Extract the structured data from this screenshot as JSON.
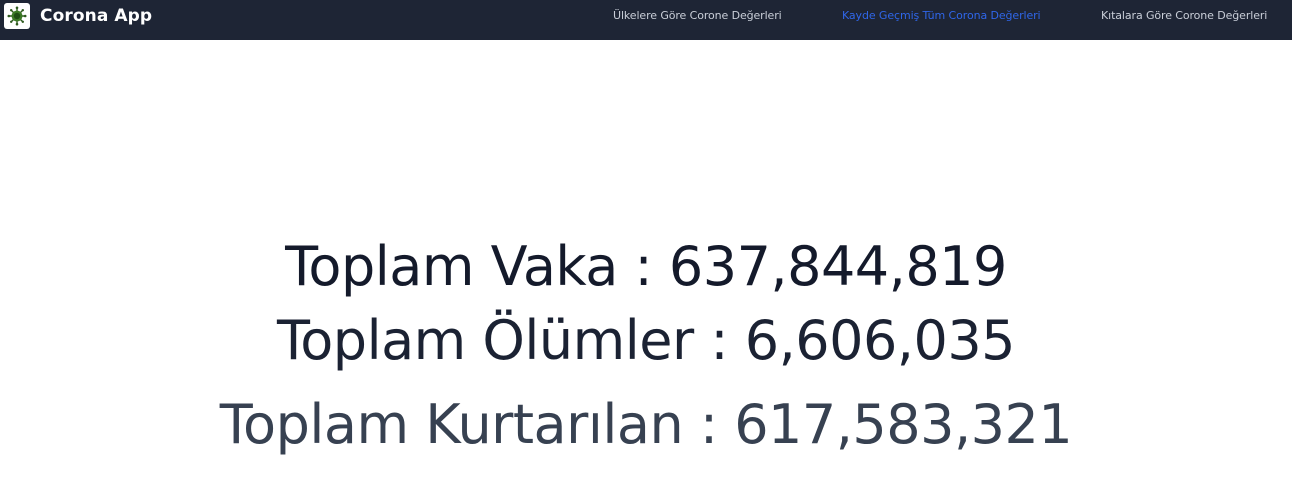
{
  "app": {
    "title": "Corona App",
    "logo_icon": "virus-icon",
    "accent_color": "#2f66e9",
    "navbar_color": "#1e2535"
  },
  "nav": {
    "items": [
      {
        "label": "Ülkelere Göre Corone Değerleri",
        "active": false
      },
      {
        "label": "Kayde Geçmiş Tüm Corona Değerleri",
        "active": true
      },
      {
        "label": "Kıtalara Göre Corone Değerleri",
        "active": false
      }
    ]
  },
  "stats": {
    "cases": "Toplam Vaka : 637,844,819",
    "deaths": "Toplam Ölümler : 6,606,035",
    "recovered": "Toplam Kurtarılan : 617,583,321"
  }
}
